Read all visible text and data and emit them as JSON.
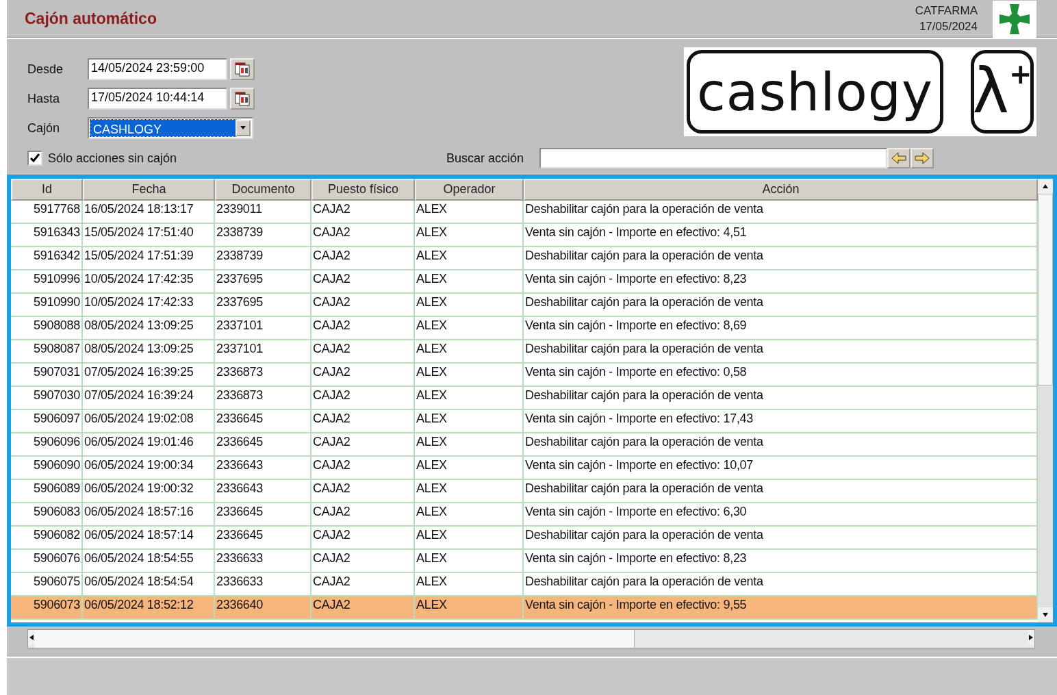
{
  "header": {
    "title": "Cajón automático",
    "company": "CATFARMA",
    "date": "17/05/2024"
  },
  "filters": {
    "desde": {
      "label": "Desde",
      "value": "14/05/2024 23:59:00"
    },
    "hasta": {
      "label": "Hasta",
      "value": "17/05/2024 10:44:14"
    },
    "cajon": {
      "label": "Cajón",
      "value": "CASHLOGY",
      "selected": true
    },
    "only_without": {
      "label": "Sólo acciones sin cajón",
      "checked": true
    },
    "search": {
      "label": "Buscar acción"
    }
  },
  "logos": {
    "brand": "cashlogy",
    "symbol": "λ",
    "symbol_mark": "+"
  },
  "table": {
    "columns": [
      "Id",
      "Fecha",
      "Documento",
      "Puesto físico",
      "Operador",
      "Acción"
    ],
    "rows": [
      {
        "cells": [
          "5917768",
          "16/05/2024 18:13:17",
          "2339011",
          "CAJA2",
          "ALEX",
          "Deshabilitar cajón para la operación de venta"
        ],
        "selected": false
      },
      {
        "cells": [
          "5916343",
          "15/05/2024 17:51:40",
          "2338739",
          "CAJA2",
          "ALEX",
          "Venta sin cajón - Importe en efectivo: 4,51"
        ],
        "selected": false
      },
      {
        "cells": [
          "5916342",
          "15/05/2024 17:51:39",
          "2338739",
          "CAJA2",
          "ALEX",
          "Deshabilitar cajón para la operación de venta"
        ],
        "selected": false
      },
      {
        "cells": [
          "5910996",
          "10/05/2024 17:42:35",
          "2337695",
          "CAJA2",
          "ALEX",
          "Venta sin cajón - Importe en efectivo: 8,23"
        ],
        "selected": false
      },
      {
        "cells": [
          "5910990",
          "10/05/2024 17:42:33",
          "2337695",
          "CAJA2",
          "ALEX",
          "Deshabilitar cajón para la operación de venta"
        ],
        "selected": false
      },
      {
        "cells": [
          "5908088",
          "08/05/2024 13:09:25",
          "2337101",
          "CAJA2",
          "ALEX",
          "Venta sin cajón - Importe en efectivo: 8,69"
        ],
        "selected": false
      },
      {
        "cells": [
          "5908087",
          "08/05/2024 13:09:25",
          "2337101",
          "CAJA2",
          "ALEX",
          "Deshabilitar cajón para la operación de venta"
        ],
        "selected": false
      },
      {
        "cells": [
          "5907031",
          "07/05/2024 16:39:25",
          "2336873",
          "CAJA2",
          "ALEX",
          "Venta sin cajón - Importe en efectivo: 0,58"
        ],
        "selected": false
      },
      {
        "cells": [
          "5907030",
          "07/05/2024 16:39:24",
          "2336873",
          "CAJA2",
          "ALEX",
          "Deshabilitar cajón para la operación de venta"
        ],
        "selected": false
      },
      {
        "cells": [
          "5906097",
          "06/05/2024 19:02:08",
          "2336645",
          "CAJA2",
          "ALEX",
          "Venta sin cajón - Importe en efectivo: 17,43"
        ],
        "selected": false
      },
      {
        "cells": [
          "5906096",
          "06/05/2024 19:01:46",
          "2336645",
          "CAJA2",
          "ALEX",
          "Deshabilitar cajón para la operación de venta"
        ],
        "selected": false
      },
      {
        "cells": [
          "5906090",
          "06/05/2024 19:00:34",
          "2336643",
          "CAJA2",
          "ALEX",
          "Venta sin cajón - Importe en efectivo: 10,07"
        ],
        "selected": false
      },
      {
        "cells": [
          "5906089",
          "06/05/2024 19:00:32",
          "2336643",
          "CAJA2",
          "ALEX",
          "Deshabilitar cajón para la operación de venta"
        ],
        "selected": false
      },
      {
        "cells": [
          "5906083",
          "06/05/2024 18:57:16",
          "2336645",
          "CAJA2",
          "ALEX",
          "Venta sin cajón - Importe en efectivo: 6,30"
        ],
        "selected": false
      },
      {
        "cells": [
          "5906082",
          "06/05/2024 18:57:14",
          "2336645",
          "CAJA2",
          "ALEX",
          "Deshabilitar cajón para la operación de venta"
        ],
        "selected": false
      },
      {
        "cells": [
          "5906076",
          "06/05/2024 18:54:55",
          "2336633",
          "CAJA2",
          "ALEX",
          "Venta sin cajón - Importe en efectivo: 8,23"
        ],
        "selected": false
      },
      {
        "cells": [
          "5906075",
          "06/05/2024 18:54:54",
          "2336633",
          "CAJA2",
          "ALEX",
          "Deshabilitar cajón para la operación de venta"
        ],
        "selected": false
      },
      {
        "cells": [
          "5906073",
          "06/05/2024 18:52:12",
          "2336640",
          "CAJA2",
          "ALEX",
          "Venta sin cajón - Importe en efectivo: 9,55"
        ],
        "selected": true
      }
    ]
  }
}
